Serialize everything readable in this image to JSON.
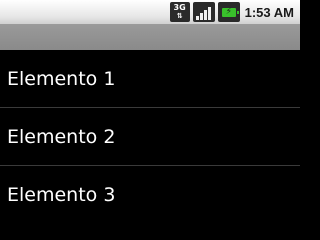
{
  "status_bar": {
    "network_type": "3G",
    "network_icon": "network-3g-icon",
    "signal_icon": "signal-strength-icon",
    "battery_icon": "battery-charging-icon",
    "time": "1:53 AM"
  },
  "list": {
    "items": [
      {
        "label": "Elemento 1"
      },
      {
        "label": "Elemento 2"
      },
      {
        "label": "Elemento 3"
      }
    ]
  },
  "colors": {
    "background": "#000000",
    "title_bar": "#8e8e8e",
    "battery": "#39c12b"
  }
}
